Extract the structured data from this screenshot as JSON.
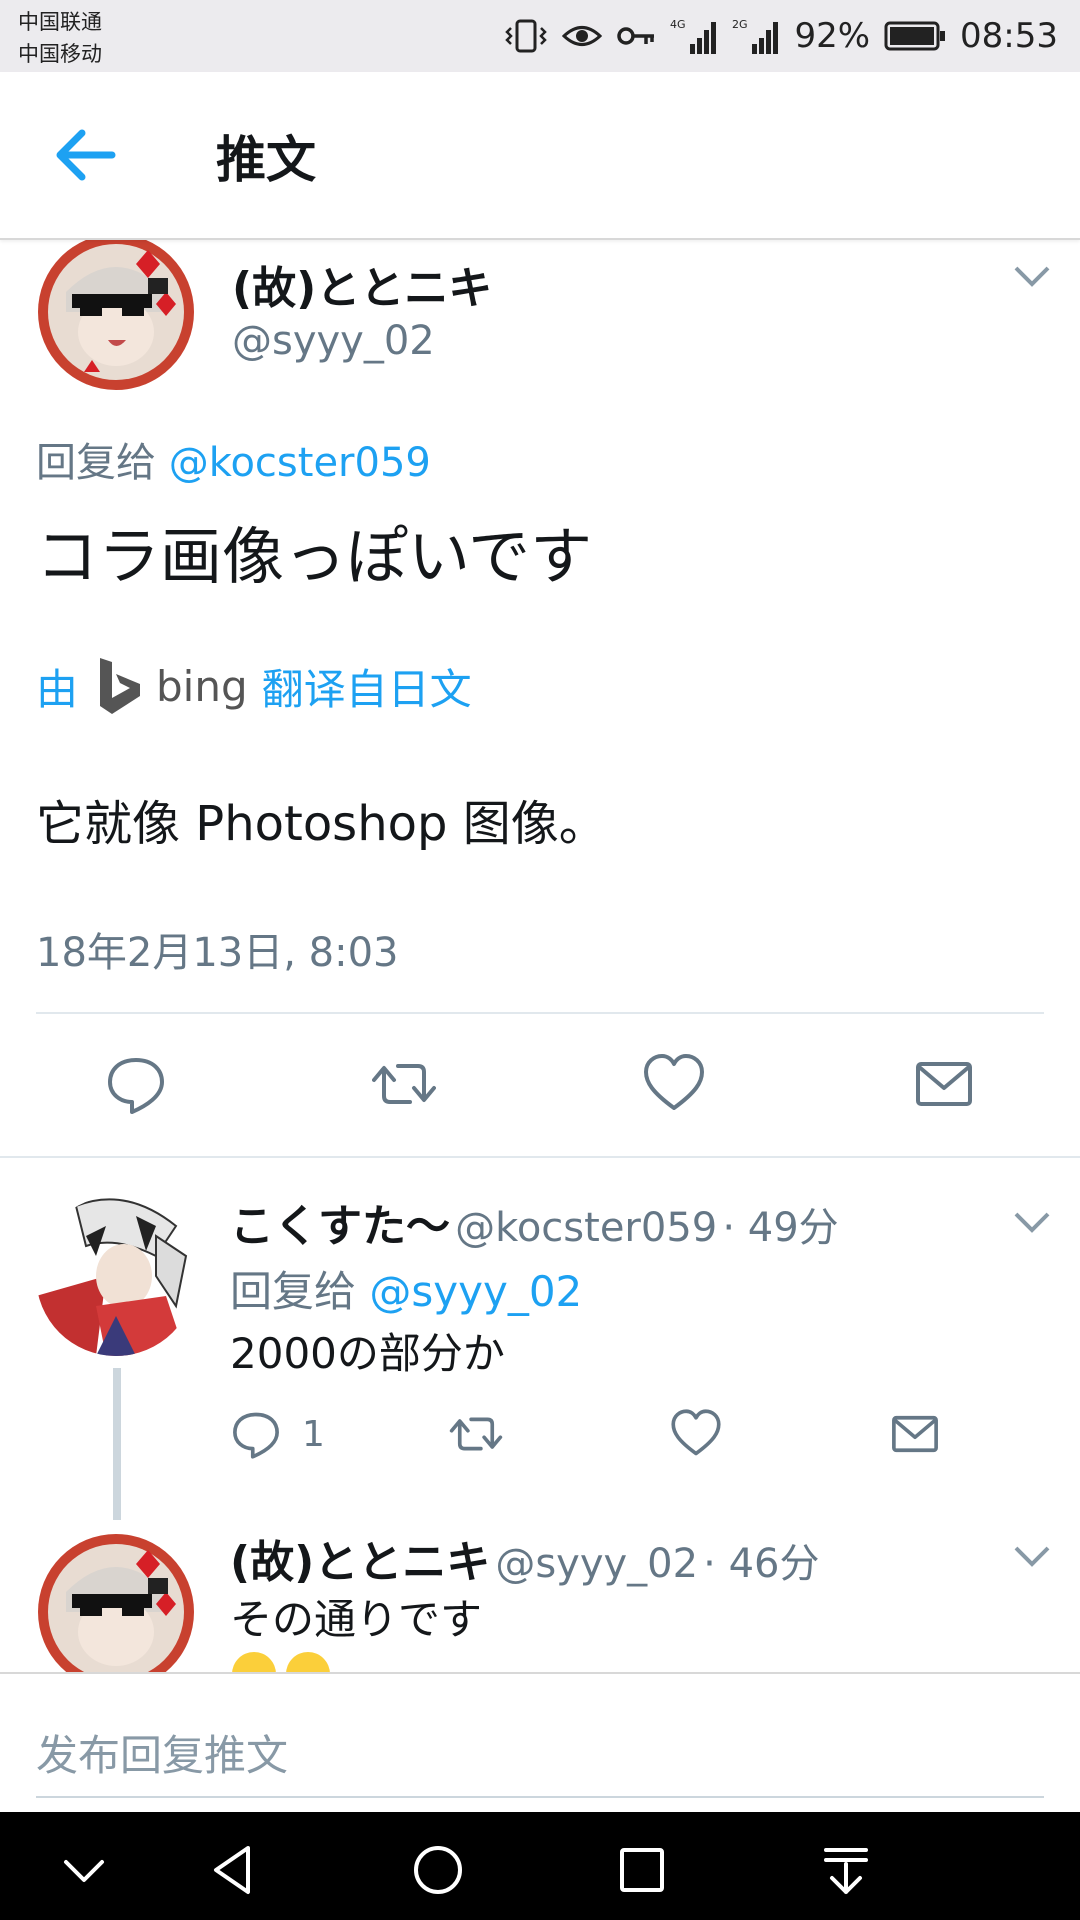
{
  "status_bar": {
    "carrier_1": "中国联通",
    "carrier_2": "中国移动",
    "signal_1_label": "4G",
    "signal_2_label": "2G",
    "battery": "92%",
    "time": "08:53"
  },
  "header": {
    "title": "推文",
    "back_icon": "arrow-left-icon"
  },
  "main_tweet": {
    "display_name": "(故)ととニキ",
    "handle": "@syyy_02",
    "reply_prefix": "回复给",
    "reply_to": "@kocster059",
    "text": "コラ画像っぽいです",
    "translate_by": "由",
    "translate_service": "bing",
    "translate_from": "翻译自日文",
    "translated_text": "它就像 Photoshop 图像。",
    "timestamp": "18年2月13日, 8:03"
  },
  "replies": [
    {
      "display_name": "こくすた～",
      "handle": "@kocster059",
      "time": "· 49分",
      "reply_prefix": "回复给",
      "reply_to": "@syyy_02",
      "text": "2000の部分か",
      "reply_count": "1"
    },
    {
      "display_name": "(故)ととニキ",
      "handle": "@syyy_02",
      "time": "· 46分",
      "text": "その通りです"
    }
  ],
  "compose": {
    "placeholder": "发布回复推文"
  },
  "colors": {
    "accent": "#1da1f2",
    "secondary_text": "#657786",
    "status_bar_bg": "#ecebee"
  }
}
